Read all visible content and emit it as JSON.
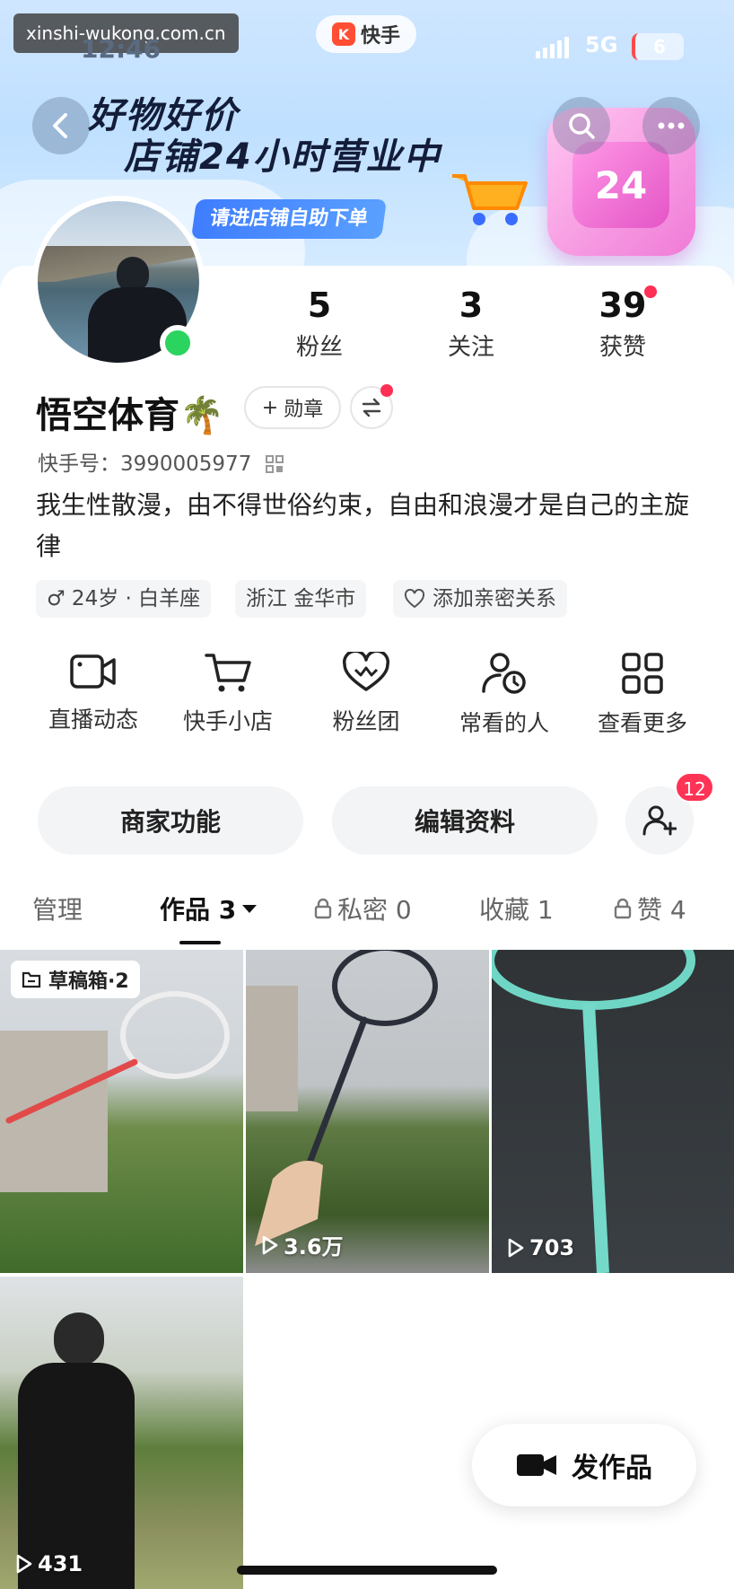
{
  "watermark": "xinshi-wukong.com.cn",
  "status_bar": {
    "time": "12:46",
    "network": "5G",
    "battery": "6"
  },
  "app_pill": {
    "logo": "K",
    "label": "快手"
  },
  "banner": {
    "line1": "好物好价",
    "line2": "店铺24小时营业中",
    "cta": "请进店铺自助下单",
    "badge_text": "24"
  },
  "profile": {
    "name": "悟空体育🌴",
    "medal_label": "勋章",
    "kuaishou_id": "快手号：3990005977",
    "bio": "我生性散漫，由不得世俗约束，自由和浪漫才是自己的主旋律",
    "tags": [
      "♂ 24岁 · 白羊座",
      "浙江 金华市",
      "添加亲密关系"
    ]
  },
  "stats": [
    {
      "num": "5",
      "label": "粉丝"
    },
    {
      "num": "3",
      "label": "关注"
    },
    {
      "num": "39",
      "label": "获赞"
    }
  ],
  "tools": [
    {
      "label": "直播动态",
      "icon": "video-camera-icon"
    },
    {
      "label": "快手小店",
      "icon": "cart-icon"
    },
    {
      "label": "粉丝团",
      "icon": "heart-icon"
    },
    {
      "label": "常看的人",
      "icon": "user-clock-icon"
    },
    {
      "label": "查看更多",
      "icon": "grid-icon"
    }
  ],
  "actions": {
    "merchant": "商家功能",
    "edit": "编辑资料",
    "friend_badge": "12"
  },
  "tabs": [
    {
      "label": "管理"
    },
    {
      "label": "作品 3"
    },
    {
      "label": "私密 0"
    },
    {
      "label": "收藏 1"
    },
    {
      "label": "赞 4"
    }
  ],
  "works": [
    {
      "draft_label": "草稿箱·2"
    },
    {
      "views": "3.6万"
    },
    {
      "views": "703"
    },
    {
      "views": "431"
    }
  ],
  "publish_label": "发作品"
}
